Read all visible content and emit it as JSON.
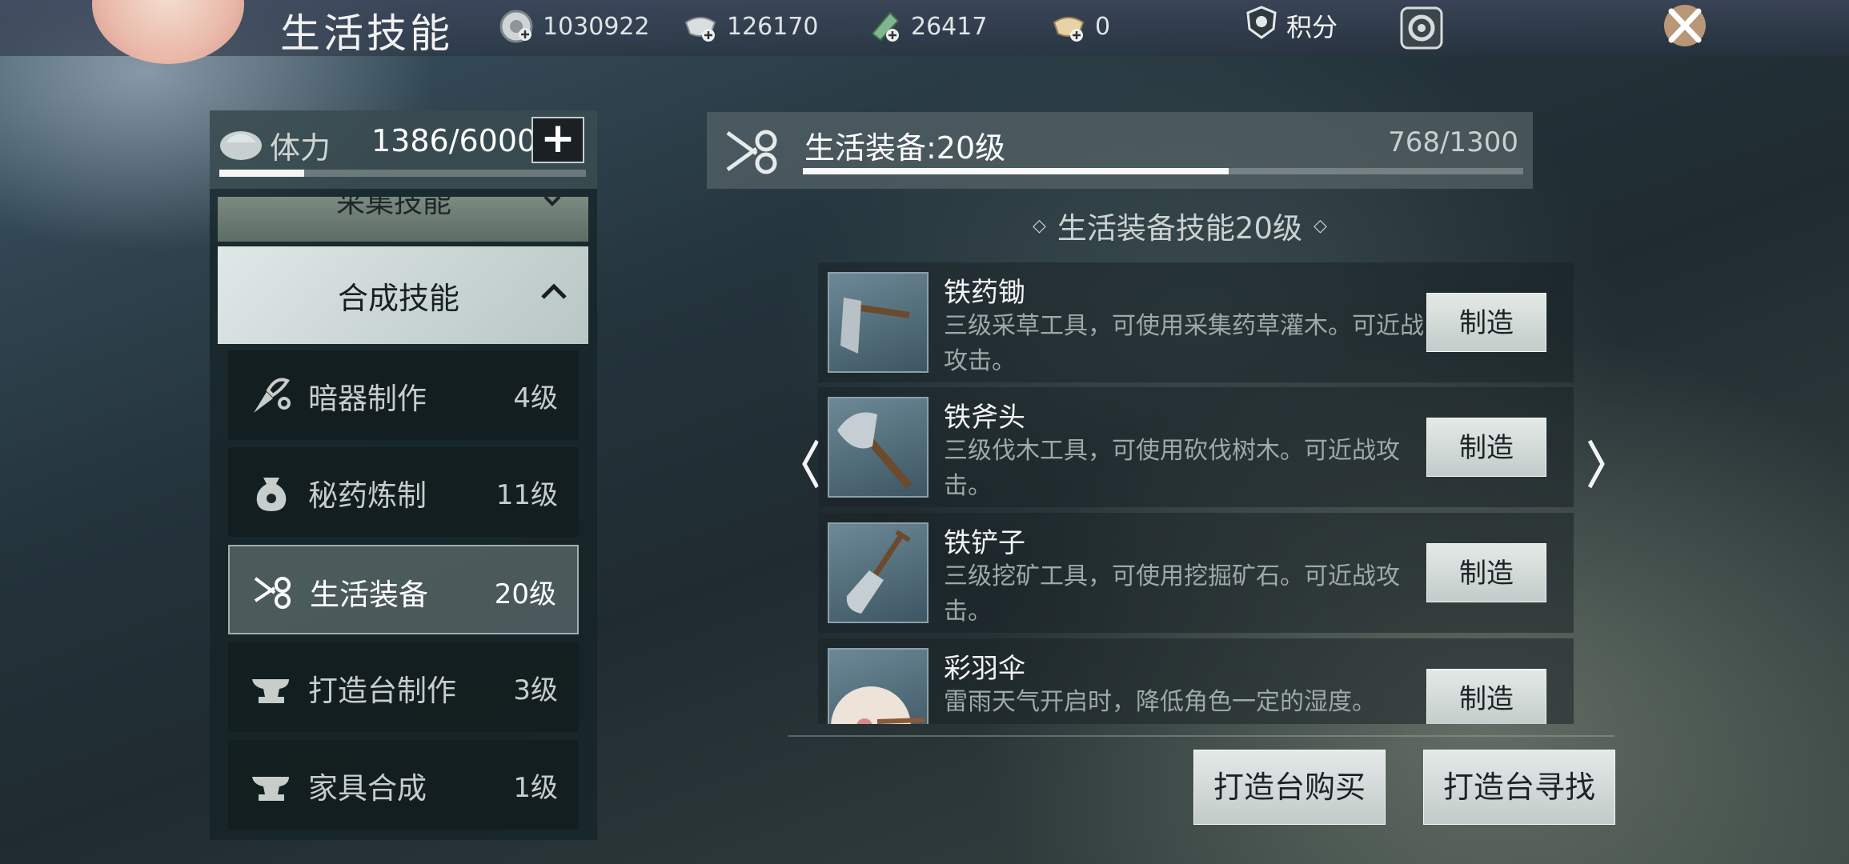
{
  "header": {
    "title": "生活技能",
    "currencies": [
      {
        "icon": "coin-icon",
        "value": "1030922"
      },
      {
        "icon": "silver-ingot-icon",
        "value": "126170"
      },
      {
        "icon": "jade-note-icon",
        "value": "26417"
      },
      {
        "icon": "gold-ingot-icon",
        "value": "0"
      }
    ],
    "score_label": "积分",
    "settings_icon": "gear-icon",
    "close_icon": "close-icon"
  },
  "stamina": {
    "label": "体力",
    "value": "1386/6000",
    "fraction": 0.231,
    "plus_label": "+"
  },
  "categories": {
    "collapsed_label": "采集技能",
    "open_label": "合成技能"
  },
  "skills": [
    {
      "icon": "dart-icon",
      "name": "暗器制作",
      "level": "4级"
    },
    {
      "icon": "potion-bag-icon",
      "name": "秘药炼制",
      "level": "11级"
    },
    {
      "icon": "scissors-icon",
      "name": "生活装备",
      "level": "20级",
      "active": true
    },
    {
      "icon": "anvil-icon",
      "name": "打造台制作",
      "level": "3级"
    },
    {
      "icon": "anvil-icon",
      "name": "家具合成",
      "level": "1级"
    }
  ],
  "detail": {
    "icon": "scissors-icon",
    "title": "生活装备:20级",
    "progress": "768/1300",
    "progress_fraction": 0.591,
    "subtitle": "生活装备技能20级"
  },
  "items": [
    {
      "icon": "hoe-icon",
      "name": "铁药锄",
      "desc": "三级采草工具，可使用采集药草灌木。可近战攻击。",
      "button": "制造"
    },
    {
      "icon": "axe-icon",
      "name": "铁斧头",
      "desc": "三级伐木工具，可使用砍伐树木。可近战攻击。",
      "button": "制造"
    },
    {
      "icon": "shovel-icon",
      "name": "铁铲子",
      "desc": "三级挖矿工具，可使用挖掘矿石。可近战攻击。",
      "button": "制造"
    },
    {
      "icon": "umbrella-icon",
      "name": "彩羽伞",
      "desc": "雷雨天气开启时，降低角色一定的湿度。",
      "button": "制造"
    }
  ],
  "buttons": {
    "buy": "打造台购买",
    "find": "打造台寻找"
  },
  "colors": {
    "accent": "#f5f5f5",
    "panel": "#14222a",
    "button": "#d7dedc"
  }
}
